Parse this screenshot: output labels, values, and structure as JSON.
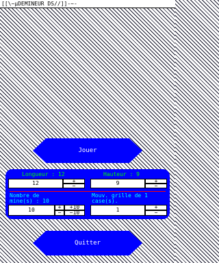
{
  "title": "[[\\~µDEMINEUR DS//]]-~-",
  "buttons": {
    "play": "Jouer",
    "quit": "Quitter"
  },
  "width_setting": {
    "label": "Longueur : 12",
    "value": "12",
    "plus": "+",
    "minus": "−"
  },
  "height_setting": {
    "label": "Hauteur : 9",
    "value": "9",
    "plus": "+",
    "minus": "−"
  },
  "mines_setting": {
    "label": "Nombre de\nmine(s) : 10",
    "value": "10",
    "plus": "+",
    "minus": "−",
    "plus10": "+10",
    "minus10": "−10"
  },
  "move_setting": {
    "label": "Mouv. grille de 1\ncase(s).",
    "value": "1",
    "plus": "+",
    "minus": "−"
  },
  "colors": {
    "button_bg": "#0000ff",
    "button_text": "#ffffff",
    "label_green": "#00ff00",
    "label_cyan": "#00ffff",
    "separator_red": "#ff0000"
  }
}
